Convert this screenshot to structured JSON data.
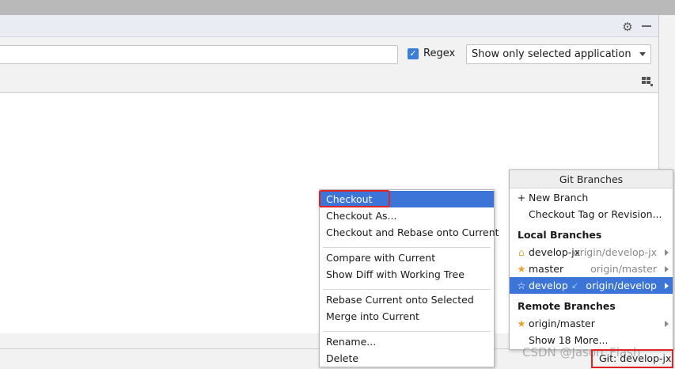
{
  "toolbar": {
    "regex_label": "Regex",
    "regex_checked": true,
    "search_value": "",
    "app_filter": "Show only selected application"
  },
  "context_menu": {
    "items": [
      {
        "label": "Checkout",
        "selected": true
      },
      {
        "label": "Checkout As..."
      },
      {
        "label": "Checkout and Rebase onto Current"
      },
      {
        "label": "Compare with Current"
      },
      {
        "label": "Show Diff with Working Tree"
      },
      {
        "label": "Rebase Current onto Selected"
      },
      {
        "label": "Merge into Current"
      },
      {
        "label": "Rename..."
      },
      {
        "label": "Delete"
      }
    ]
  },
  "branches": {
    "title": "Git Branches",
    "new_branch": "New Branch",
    "checkout_tag": "Checkout Tag or Revision...",
    "local_header": "Local Branches",
    "local": [
      {
        "name": "develop-jx",
        "remote": "origin/develop-jx",
        "icon": "tag-icon"
      },
      {
        "name": "master",
        "remote": "origin/master",
        "icon": "star-icon"
      },
      {
        "name": "develop",
        "remote": "origin/develop",
        "icon": "star-outline-icon",
        "selected": true
      }
    ],
    "remote_header": "Remote Branches",
    "remote": [
      {
        "name": "origin/master",
        "icon": "star-icon"
      }
    ],
    "show_more": "Show 18 More..."
  },
  "status": {
    "git_branch": "Git: develop-jx",
    "watermark": "CSDN @Jason_Flash"
  },
  "colors": {
    "selection": "#3c74d8",
    "annotation": "#e02424",
    "favorite_star": "#f0a030"
  }
}
